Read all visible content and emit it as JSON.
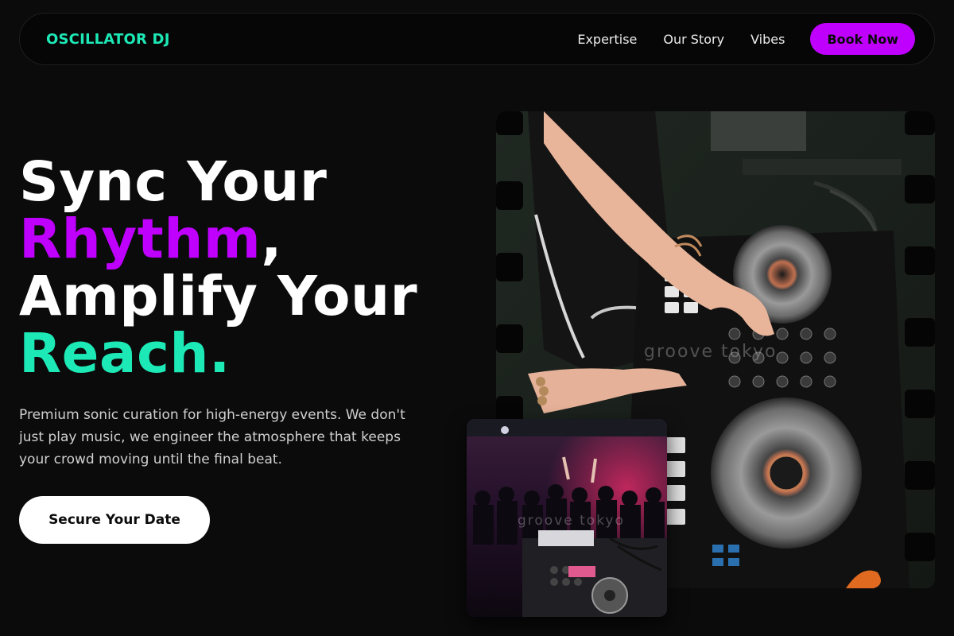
{
  "nav": {
    "logo": "OSCILLATOR DJ",
    "links": [
      "Expertise",
      "Our Story",
      "Vibes"
    ],
    "cta": "Book Now"
  },
  "hero": {
    "line1": "Sync Your",
    "line2_highlight": "Rhythm",
    "line2_rest": ",",
    "line3": "Amplify Your",
    "line4": "Reach.",
    "description": "Premium sonic curation for high-energy events. We don't just play music, we engineer the atmosphere that keeps your crowd moving until the final beat.",
    "cta": "Secure Your Date"
  },
  "images": {
    "main_watermark": "groove tokyo",
    "inset_watermark": "groove tokyo"
  },
  "colors": {
    "accent_purple": "#bf00ff",
    "accent_teal": "#1de9b6",
    "background": "#0b0b0b"
  }
}
